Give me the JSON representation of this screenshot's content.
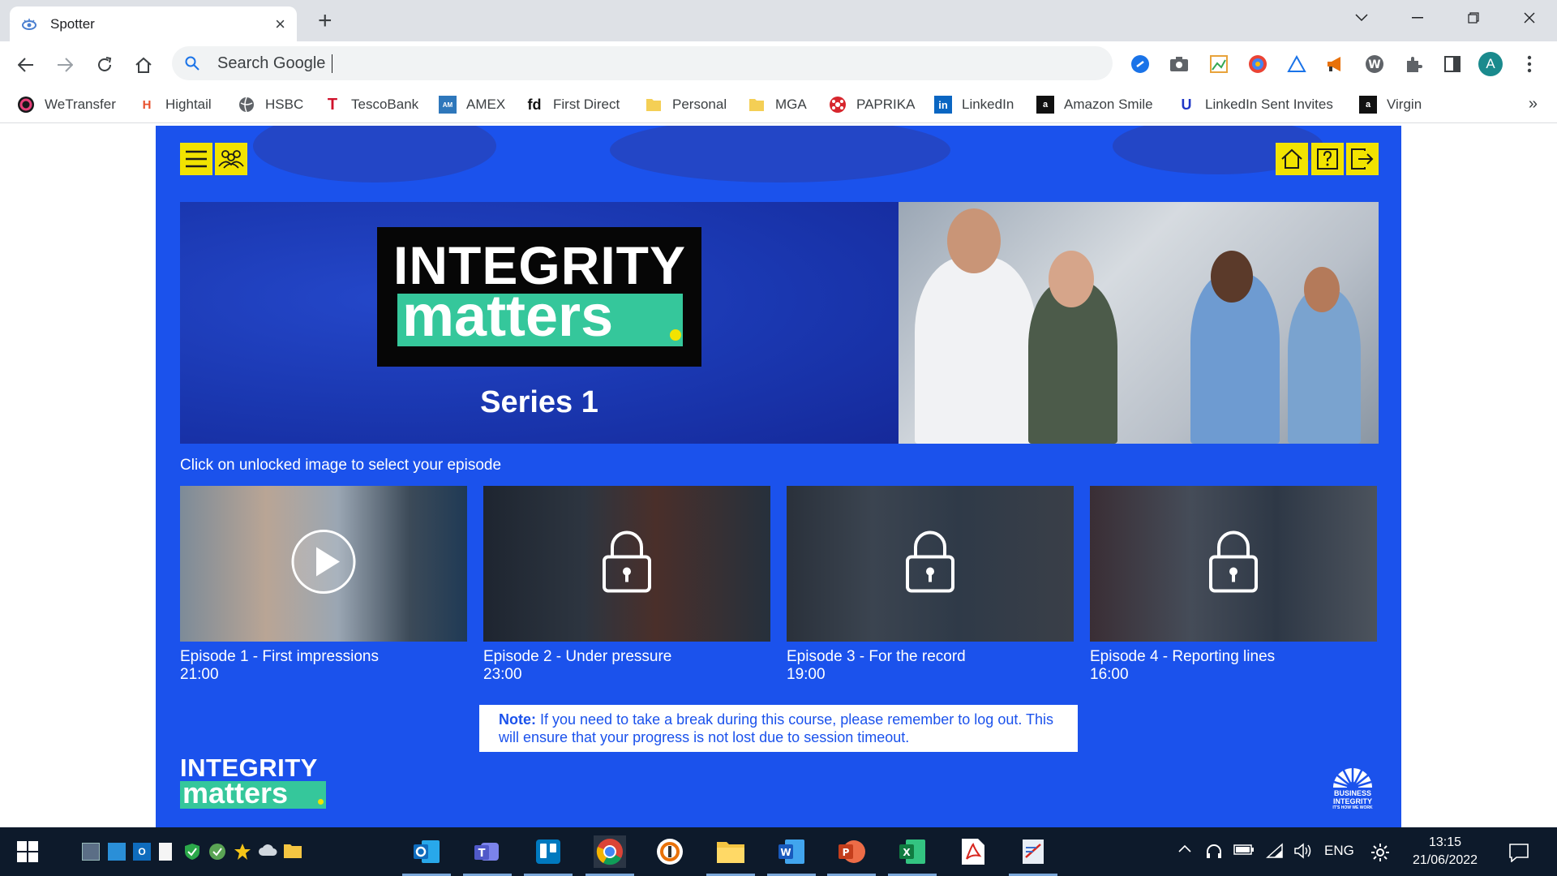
{
  "browser": {
    "tab_title": "Spotter",
    "address_placeholder": "Search Google",
    "bookmarks": [
      {
        "label": "WeTransfer",
        "icon": "wetransfer-icon"
      },
      {
        "label": "Hightail",
        "icon": "hightail-icon"
      },
      {
        "label": "HSBC",
        "icon": "globe-icon"
      },
      {
        "label": "TescoBank",
        "icon": "tescobank-icon"
      },
      {
        "label": "AMEX",
        "icon": "amex-icon"
      },
      {
        "label": "First Direct",
        "icon": "firstdirect-icon"
      },
      {
        "label": "Personal",
        "icon": "folder-icon"
      },
      {
        "label": "MGA",
        "icon": "folder-icon"
      },
      {
        "label": "PAPRIKA",
        "icon": "paprika-icon"
      },
      {
        "label": "LinkedIn",
        "icon": "linkedin-icon"
      },
      {
        "label": "Amazon Smile",
        "icon": "amazon-icon"
      },
      {
        "label": "LinkedIn Sent Invites",
        "icon": "unilever-icon"
      },
      {
        "label": "Virgin",
        "icon": "amazon-icon"
      }
    ],
    "profile_initial": "A"
  },
  "course": {
    "logo_top": "INTEGRITY",
    "logo_bottom": "matters",
    "series": "Series 1",
    "instruction": "Click on unlocked image to select your episode",
    "episodes": [
      {
        "title": "Episode 1 - First impressions",
        "duration": "21:00",
        "state": "unlocked"
      },
      {
        "title": "Episode 2 - Under pressure",
        "duration": "23:00",
        "state": "locked"
      },
      {
        "title": "Episode 3 - For the record",
        "duration": "19:00",
        "state": "locked"
      },
      {
        "title": "Episode 4 - Reporting lines",
        "duration": "16:00",
        "state": "locked"
      }
    ],
    "note_label": "Note:",
    "note_text": " If you need to take a break during this course, please remember to log out. This will ensure that your progress is not lost due to session timeout.",
    "footer_logo_top": "INTEGRITY",
    "footer_logo_bottom": "matters",
    "bi_logo_line1": "BUSINESS",
    "bi_logo_line2": "INTEGRITY",
    "bi_logo_line3": "IT'S HOW WE WORK"
  },
  "colors": {
    "course_blue": "#1b52ec",
    "accent_yellow": "#f2e300",
    "logo_green": "#35c79b",
    "active_outline": "#d8336a"
  },
  "taskbar": {
    "language": "ENG",
    "time": "13:15",
    "date": "21/06/2022"
  }
}
